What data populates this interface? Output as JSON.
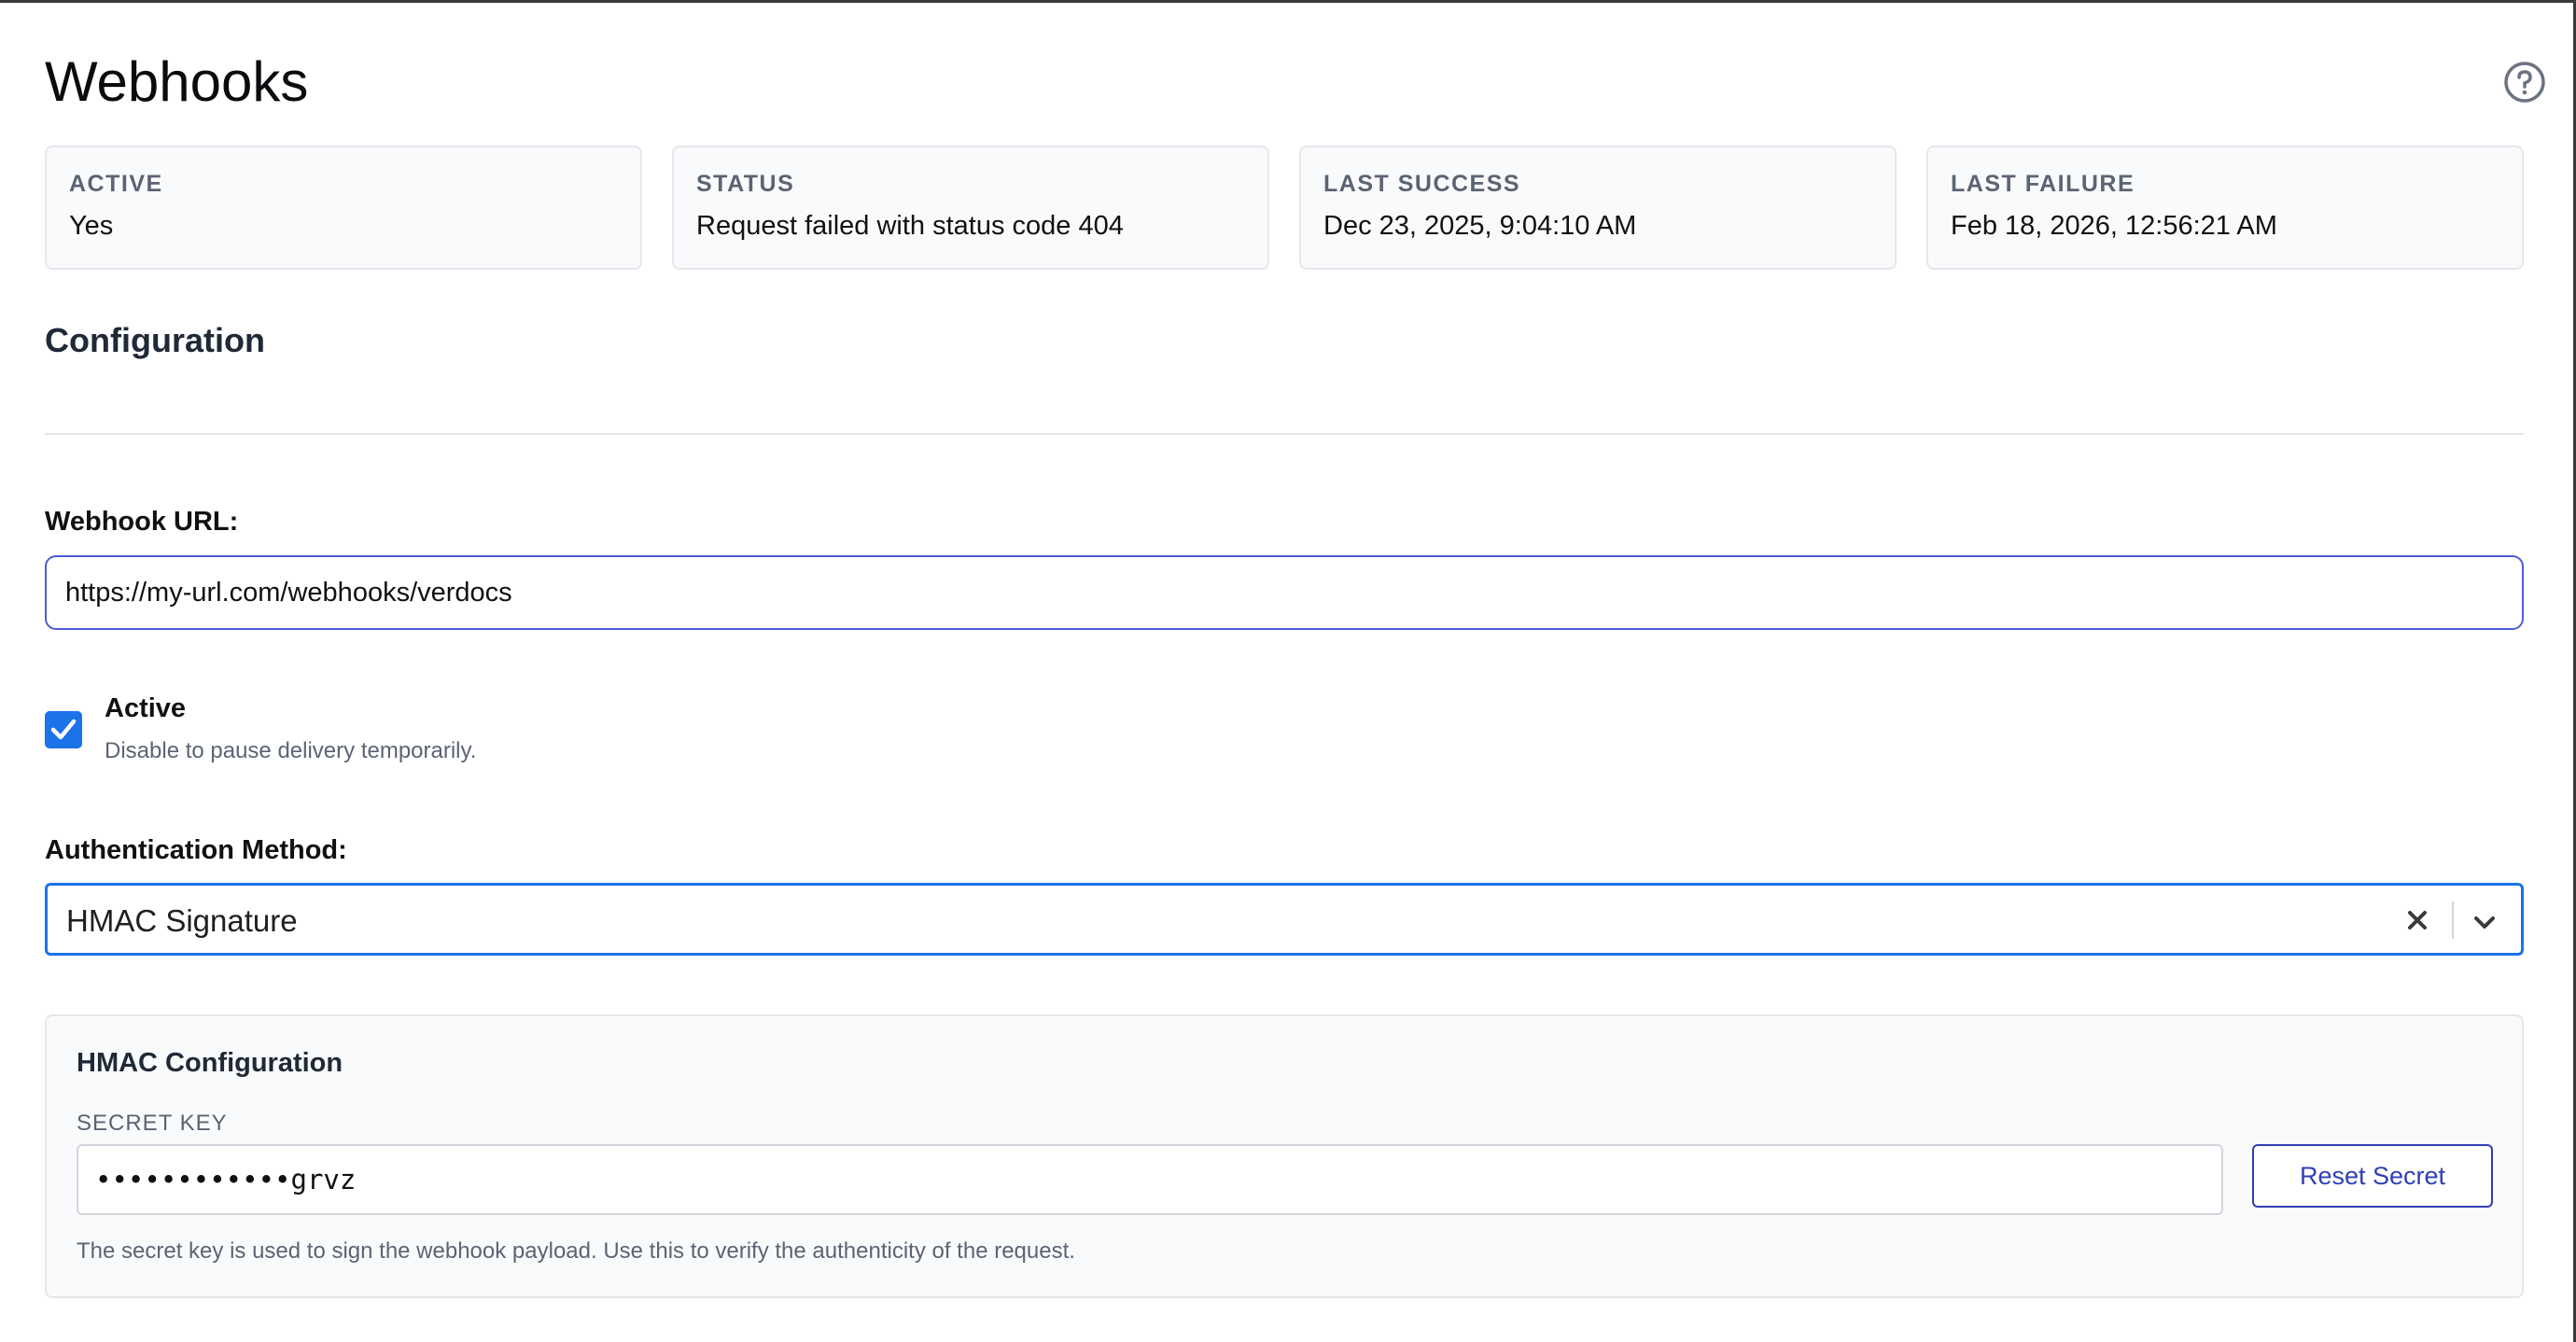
{
  "header": {
    "title": "Webhooks"
  },
  "stats": [
    {
      "label": "ACTIVE",
      "value": "Yes"
    },
    {
      "label": "STATUS",
      "value": "Request failed with status code 404"
    },
    {
      "label": "LAST SUCCESS",
      "value": "Dec 23, 2025, 9:04:10 AM"
    },
    {
      "label": "LAST FAILURE",
      "value": "Feb 18, 2026, 12:56:21 AM"
    }
  ],
  "configuration": {
    "title": "Configuration",
    "webhook_url_label": "Webhook URL:",
    "webhook_url_value": "https://my-url.com/webhooks/verdocs",
    "active_label": "Active",
    "active_help": "Disable to pause delivery temporarily.",
    "active_checked": true,
    "auth_method_label": "Authentication Method:",
    "auth_method_value": "HMAC Signature"
  },
  "hmac": {
    "title": "HMAC Configuration",
    "secret_label": "SECRET KEY",
    "secret_value": "••••••••••••grvz",
    "reset_label": "Reset Secret",
    "help": "The secret key is used to sign the webhook payload. Use this to verify the authenticity of the request."
  },
  "colors": {
    "accent": "#1a73e8",
    "url_border": "#4f5bd5",
    "reset_button": "#2f3fb5"
  },
  "icons": {
    "help": "help-circle-icon",
    "check": "check-icon",
    "clear": "close-icon",
    "dropdown": "chevron-down-icon"
  }
}
